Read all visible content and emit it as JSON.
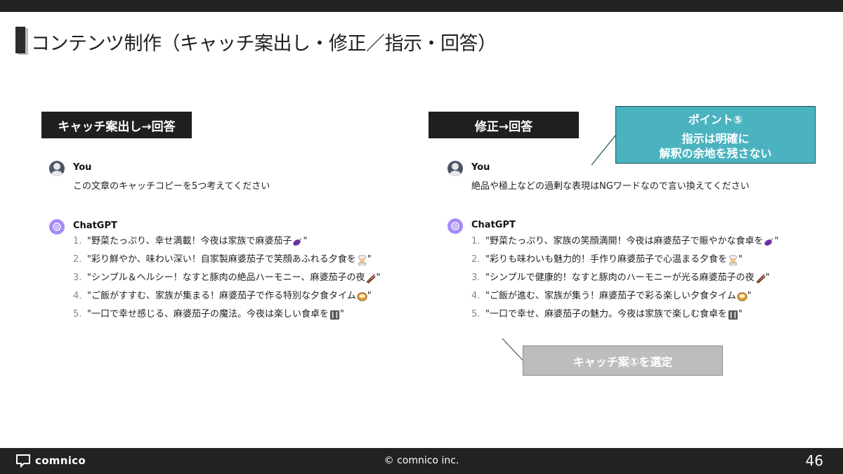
{
  "slide": {
    "title": "コンテンツ制作（キャッチ案出し・修正／指示・回答）",
    "page_number": "46",
    "copyright": "© comnico inc.",
    "brand": "comnico"
  },
  "left": {
    "header": "キャッチ案出し→回答",
    "user": {
      "name": "You",
      "message": "この文章のキャッチコピーを5つ考えてください"
    },
    "assistant": {
      "name": "ChatGPT",
      "items": [
        {
          "num": "1.",
          "text": "\"野菜たっぷり、幸せ満載！今夜は家族で麻婆茄子",
          "emoji": "eggplant-icon",
          "end": "\""
        },
        {
          "num": "2.",
          "text": "\"彩り鮮やか、味わい深い！自家製麻婆茄子で笑顔あふれる夕食を",
          "emoji": "cook-icon",
          "end": "\""
        },
        {
          "num": "3.",
          "text": "\"シンプル＆ヘルシー！なすと豚肉の絶品ハーモニー、麻婆茄子の夜",
          "emoji": "chopsticks-icon",
          "end": "\""
        },
        {
          "num": "4.",
          "text": "\"ご飯がすすむ、家族が集まる！麻婆茄子で作る特別な夕食タイム",
          "emoji": "curry-bowl-icon",
          "end": "\""
        },
        {
          "num": "5.",
          "text": "\"一口で幸せ感じる、麻婆茄子の魔法。今夜は楽しい食卓を",
          "emoji": "cutlery-icon",
          "end": "\""
        }
      ]
    }
  },
  "right": {
    "header": "修正→回答",
    "user": {
      "name": "You",
      "message": "絶品や極上などの過剰な表現はNGワードなので言い換えてください"
    },
    "assistant": {
      "name": "ChatGPT",
      "items": [
        {
          "num": "1.",
          "text": "\"野菜たっぷり、家族の笑顔満開！今夜は麻婆茄子で賑やかな食卓を",
          "emoji": "eggplant-icon",
          "end": "\""
        },
        {
          "num": "2.",
          "text": "\"彩りも味わいも魅力的！手作り麻婆茄子で心温まる夕食を",
          "emoji": "cook-icon",
          "end": "\""
        },
        {
          "num": "3.",
          "text": "\"シンプルで健康的！なすと豚肉のハーモニーが光る麻婆茄子の夜",
          "emoji": "chopsticks-icon",
          "end": "\""
        },
        {
          "num": "4.",
          "text": "\"ご飯が進む、家族が集う！麻婆茄子で彩る楽しい夕食タイム",
          "emoji": "curry-bowl-icon",
          "end": "\""
        },
        {
          "num": "5.",
          "text": "\"一口で幸せ、麻婆茄子の魅力。今夜は家族で楽しむ食卓を",
          "emoji": "cutlery-icon",
          "end": "\""
        }
      ]
    }
  },
  "callouts": {
    "point_title": "ポイント⑤",
    "point_line1": "指示は明確に",
    "point_line2": "解釈の余地を残さない",
    "select_label": "キャッチ案①を選定"
  },
  "colors": {
    "header_bg": "#1f1f1f",
    "point_bg": "#4ab3bf",
    "select_bg": "#bdbdbd",
    "gpt_avatar": "#a78bfa"
  }
}
